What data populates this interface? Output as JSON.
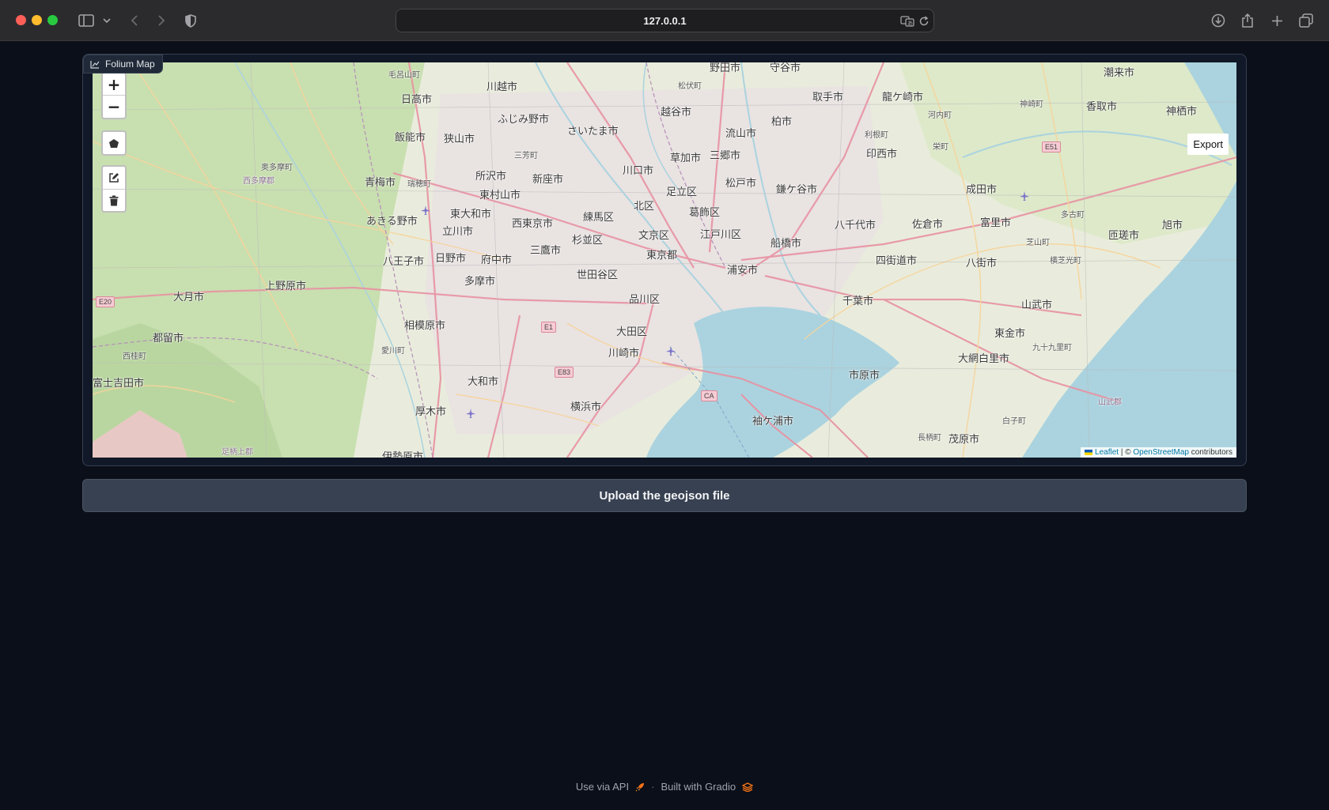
{
  "browser": {
    "url": "127.0.0.1",
    "icons": [
      "sidebar-icon",
      "chevron-down-icon",
      "back-icon",
      "forward-icon",
      "shield-icon",
      "translate-icon",
      "reload-icon",
      "download-icon",
      "share-icon",
      "new-tab-icon",
      "tabs-overview-icon"
    ]
  },
  "map_block": {
    "label": "Folium Map",
    "zoom_in": "+",
    "zoom_out": "−",
    "export_label": "Export",
    "attribution": {
      "leaflet": "Leaflet",
      "separator": " | © ",
      "osm": "OpenStreetMap",
      "suffix": " contributors"
    },
    "places": [
      "毛呂山町",
      "日高市",
      "川越市",
      "ふじみ野市",
      "さいたま市",
      "越谷市",
      "松伏町",
      "野田市",
      "守谷市",
      "取手市",
      "龍ケ崎市",
      "潮来市",
      "神栖市",
      "香取市",
      "神崎町",
      "河内町",
      "利根町",
      "栄町",
      "印西市",
      "柏市",
      "流山市",
      "三郷市",
      "草加市",
      "川口市",
      "飯能市",
      "狭山市",
      "三芳町",
      "所沢市",
      "新座市",
      "奥多摩町",
      "西多摩郡",
      "青梅市",
      "瑞穂町",
      "東村山市",
      "東大和市",
      "西東京市",
      "練馬区",
      "北区",
      "足立区",
      "葛飾区",
      "松戸市",
      "鎌ケ谷市",
      "成田市",
      "多古町",
      "匝瑳市",
      "旭市",
      "芝山町",
      "横芝光町",
      "富里市",
      "八千代市",
      "佐倉市",
      "四街道市",
      "八街市",
      "山武市",
      "東金市",
      "九十九里町",
      "大網白里市",
      "あきる野市",
      "立川市",
      "杉並区",
      "文京区",
      "江戸川区",
      "船橋市",
      "八王子市",
      "日野市",
      "府中市",
      "三鷹市",
      "東京都",
      "浦安市",
      "千葉市",
      "世田谷区",
      "上野原市",
      "大月市",
      "多摩市",
      "品川区",
      "都留市",
      "相模原市",
      "大田区",
      "川崎市",
      "西桂町",
      "愛川町",
      "市原市",
      "富士吉田市",
      "大和市",
      "厚木市",
      "横浜市",
      "袖ケ浦市",
      "長柄町",
      "茂原市",
      "白子町",
      "山武郡",
      "足柄上郡",
      "伊勢原市"
    ],
    "shields": [
      "E20",
      "E1",
      "E83",
      "CA",
      "E51"
    ],
    "tools": [
      "polygon-draw-icon",
      "edit-layers-icon",
      "delete-layers-icon"
    ]
  },
  "upload_button": {
    "label": "Upload the geojson file"
  },
  "footer": {
    "api_link": "Use via API",
    "separator": "·",
    "built_with": "Built with Gradio"
  }
}
